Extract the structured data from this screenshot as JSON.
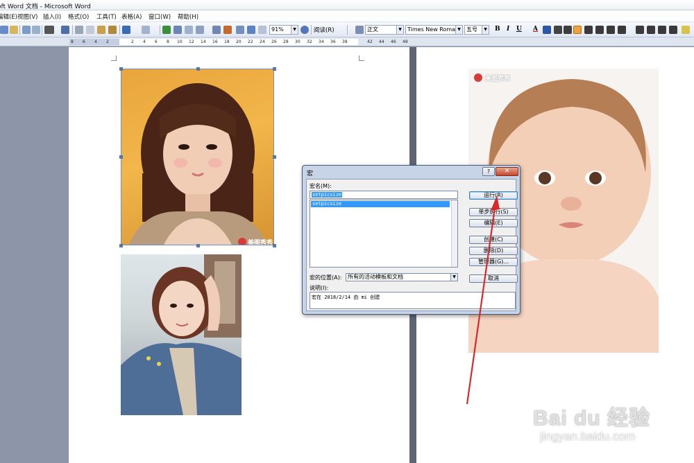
{
  "window": {
    "title": "oft Word 文档 - Microsoft Word"
  },
  "menu": [
    "编辑(E)",
    "视图(V)",
    "插入(I)",
    "格式(O)",
    "工具(T)",
    "表格(A)",
    "窗口(W)",
    "帮助(H)"
  ],
  "toolbar": {
    "zoom": "91%",
    "read_label": "阅读(R)",
    "style": "正文",
    "font": "Times New Roman",
    "size": "五号",
    "bold": "B",
    "italic": "I",
    "underline": "U",
    "font_color": "A"
  },
  "ruler": {
    "ticks": [
      "8",
      "6",
      "4",
      "2",
      "",
      "2",
      "4",
      "6",
      "8",
      "10",
      "12",
      "14",
      "16",
      "18",
      "20",
      "22",
      "24",
      "26",
      "28",
      "30",
      "32",
      "34",
      "36",
      "38",
      "",
      "42",
      "44",
      "46",
      "48"
    ]
  },
  "photos": {
    "watermark_label": "美图秀秀"
  },
  "dialog": {
    "title": "宏",
    "help": "?",
    "close": "✕",
    "macro_name_label": "宏名(M):",
    "macro_name_value": "setpicsize",
    "macro_list": [
      "setpicsize"
    ],
    "buttons": {
      "run": "运行(R)",
      "step": "单步执行(S)",
      "edit": "编辑(E)",
      "create": "创建(C)",
      "delete": "删除(D)",
      "organizer": "管理器(G)...",
      "cancel": "取消"
    },
    "location_label": "宏的位置(A):",
    "location_value": "所有的活动模板和文档",
    "description_label": "说明(I):",
    "description_value": "宏在 2018/2/14 由 mi 创建"
  },
  "watermark": {
    "brand": "Bai du 经验",
    "url": "jingyan.baidu.com"
  },
  "colors": {
    "accent": "#3399ff",
    "close_red": "#c8482c",
    "arrow": "#d42a2a"
  }
}
